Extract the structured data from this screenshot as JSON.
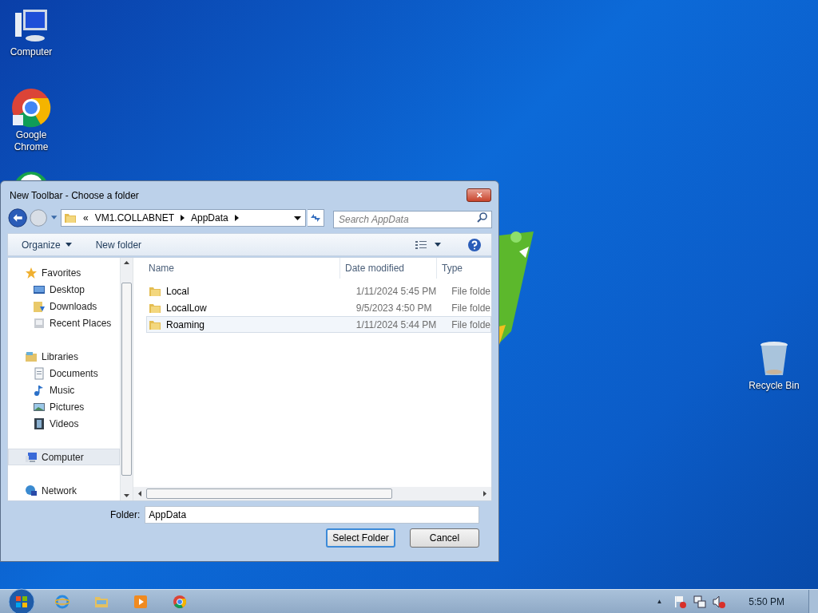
{
  "desktop": {
    "icons": [
      {
        "kind": "computer",
        "label": "Computer"
      },
      {
        "kind": "chrome",
        "label": "Google Chrome"
      },
      {
        "kind": "green-app"
      },
      {
        "kind": "recycle",
        "label": "Recycle Bin"
      }
    ]
  },
  "dialog": {
    "title": "New Toolbar - Choose a folder",
    "close": "✕",
    "address": {
      "overflow": "«",
      "crumbs": [
        "VM1.COLLABNET",
        "AppData"
      ]
    },
    "search": {
      "placeholder": "Search AppData"
    },
    "toolbar": [
      "Organize",
      "New folder"
    ],
    "nav": [
      {
        "label": "Favorites",
        "kind": "favorites",
        "selected": false,
        "children": [
          {
            "label": "Desktop",
            "kind": "desktop",
            "selected": false
          },
          {
            "label": "Downloads",
            "kind": "downloads",
            "selected": false
          },
          {
            "label": "Recent Places",
            "kind": "recent",
            "selected": false
          }
        ]
      },
      {
        "label": "Libraries",
        "kind": "libraries",
        "selected": false,
        "children": [
          {
            "label": "Documents",
            "kind": "documents",
            "selected": false
          },
          {
            "label": "Music",
            "kind": "music",
            "selected": false
          },
          {
            "label": "Pictures",
            "kind": "pictures",
            "selected": false
          },
          {
            "label": "Videos",
            "kind": "videos",
            "selected": false
          }
        ]
      },
      {
        "label": "Computer",
        "kind": "computer",
        "selected": true
      },
      {
        "label": "Network",
        "kind": "network",
        "selected": false
      }
    ],
    "columns": [
      "Name",
      "Date modified",
      "Type"
    ],
    "rows": [
      {
        "name": "Local",
        "date": "1/11/2024 5:45 PM",
        "type": "File folde",
        "hovered": false
      },
      {
        "name": "LocalLow",
        "date": "9/5/2023 4:50 PM",
        "type": "File folde",
        "hovered": false
      },
      {
        "name": "Roaming",
        "date": "1/11/2024 5:44 PM",
        "type": "File folde",
        "hovered": true
      }
    ],
    "folder": {
      "label": "Folder:",
      "value": "AppData"
    },
    "buttons": [
      {
        "label": "Select Folder",
        "default": true
      },
      {
        "label": "Cancel",
        "default": false
      }
    ]
  },
  "taskbar": {
    "apps": [
      {
        "kind": "ie"
      },
      {
        "kind": "explorer"
      },
      {
        "kind": "media"
      },
      {
        "kind": "chrome"
      }
    ],
    "tray": {
      "show_hidden": "▲",
      "time": "5:50 PM"
    }
  }
}
